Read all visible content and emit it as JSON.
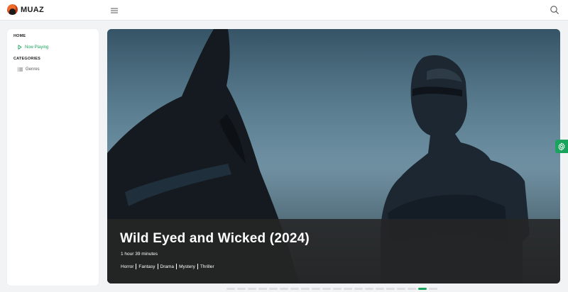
{
  "header": {
    "app_name": "MUAZ",
    "menu_icon": "hamburger-menu-icon",
    "search_icon": "search-icon"
  },
  "sidebar": {
    "sections": [
      {
        "title": "HOME",
        "items": [
          {
            "label": "Now Playing",
            "icon": "play-icon",
            "active": true
          }
        ]
      },
      {
        "title": "CATEGORIES",
        "items": [
          {
            "label": "Genres",
            "icon": "list-icon",
            "active": false
          }
        ]
      }
    ]
  },
  "hero": {
    "title": "Wild Eyed and Wicked (2024)",
    "duration": "1 hour 39 minutes",
    "genres": [
      "Horror",
      "Fantasy",
      "Drama",
      "Mystery",
      "Thriller"
    ]
  },
  "carousel": {
    "total_slides": 20,
    "active_index": 18
  },
  "settings_icon": "gear-icon",
  "colors": {
    "accent": "#1aa35c",
    "caption_bg": "#262626",
    "page_bg": "#f2f3f5"
  }
}
